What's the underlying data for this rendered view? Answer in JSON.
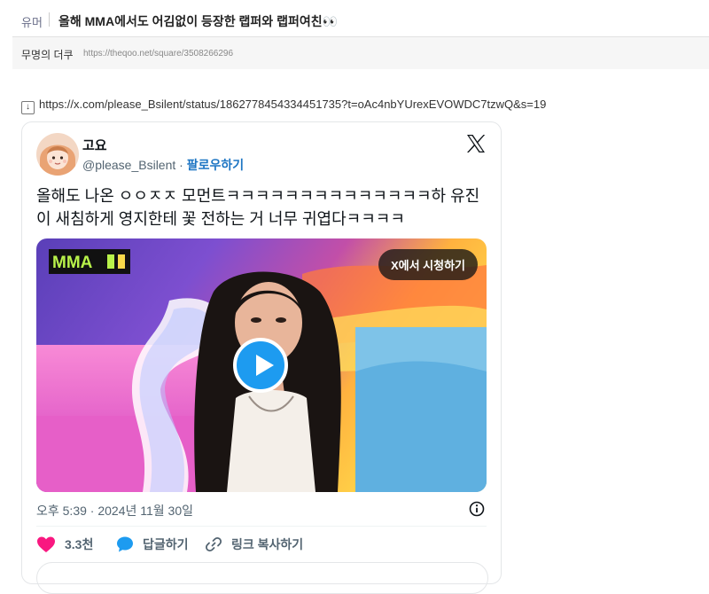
{
  "post": {
    "category": "유머",
    "title": "올해 MMA에서도 어김없이 등장한 랩퍼와 랩퍼여친👀",
    "author": "무명의 더쿠",
    "url": "https://theqoo.net/square/3508266296"
  },
  "link": {
    "arrow_icon": "down-arrow-icon",
    "url": "https://x.com/please_Bsilent/status/1862778454334451735?t=oAc4nbYUrexEVOWDC7tzwQ&s=19"
  },
  "tweet": {
    "display_name": "고요",
    "handle": "@please_Bsilent",
    "dot": "·",
    "follow_label": "팔로우하기",
    "text": "올해도 나온 ㅇㅇㅈㅈ 모먼트ㅋㅋㅋㅋㅋㅋㅋㅋㅋㅋㅋㅋㅋㅋ하 유진이 새침하게 영지한테 꽃 전하는 거 너무 귀엽다ㅋㅋㅋㅋ",
    "media": {
      "watch_label": "X에서 시청하기",
      "logo_text": "MMA"
    },
    "timestamp": "오후 5:39 · 2024년 11월 30일",
    "actions": {
      "like_count": "3.3천",
      "reply_label": "답글하기",
      "copy_link_label": "링크 복사하기"
    },
    "colors": {
      "like": "#f91880",
      "reply": "#1d9bf0",
      "follow": "#1d75c3"
    }
  }
}
